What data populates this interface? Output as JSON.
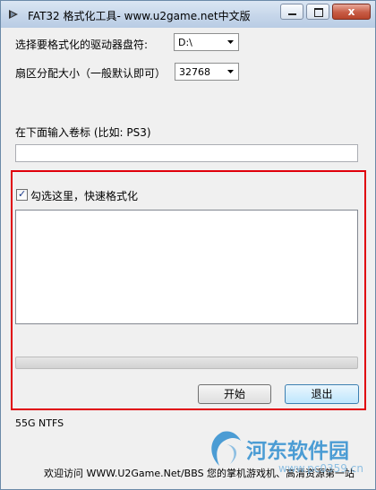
{
  "window": {
    "title": "FAT32 格式化工具- www.u2game.net中文版",
    "minimize_icon": "minimize-icon",
    "maximize_icon": "maximize-icon",
    "close_icon": "close-icon",
    "close_glyph": "x"
  },
  "form": {
    "drive_label": "选择要格式化的驱动器盘符:",
    "drive_value": "D:\\",
    "cluster_label": "扇区分配大小（一般默认即可）",
    "cluster_value": "32768",
    "volume_label_prompt": "在下面输入卷标 (比如: PS3)",
    "volume_label_value": "",
    "quick_format_label": "勾选这里，快速格式化",
    "quick_format_checked": true,
    "log_text": "",
    "progress": 0
  },
  "buttons": {
    "start": "开始",
    "exit": "退出"
  },
  "status": "55G NTFS",
  "footer": "欢迎访问 WWW.U2Game.Net/BBS 您的掌机游戏机、高清资源第一站",
  "watermark": {
    "text": "河东软件园",
    "url": "www.pc0359.cn"
  },
  "colors": {
    "highlight_frame": "#e0000a",
    "watermark": "#2f8ed0"
  }
}
